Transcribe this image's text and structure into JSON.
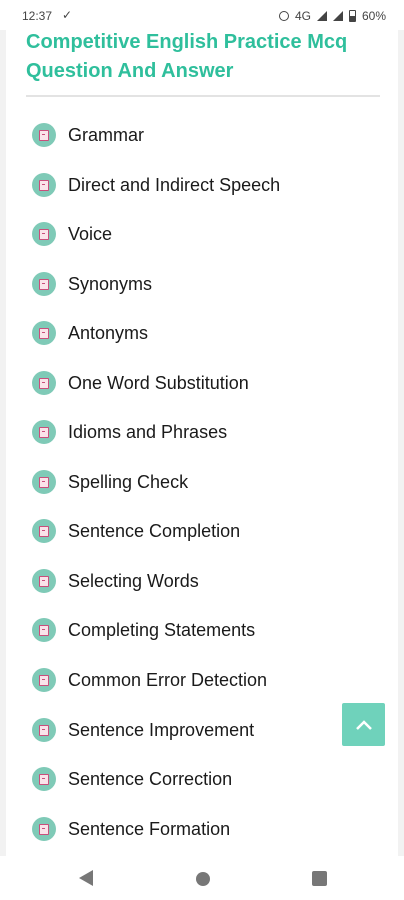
{
  "status_bar": {
    "time": "12:37",
    "check_icon": "check-icon",
    "network": "4G",
    "battery": "60%"
  },
  "page": {
    "title": "Competitive English Practice Mcq Question And Answer",
    "accent_color": "#2fbf9c"
  },
  "topics": [
    {
      "label": "Grammar",
      "icon": "book-icon"
    },
    {
      "label": "Direct and Indirect Speech",
      "icon": "book-icon"
    },
    {
      "label": "Voice",
      "icon": "book-icon"
    },
    {
      "label": "Synonyms",
      "icon": "book-icon"
    },
    {
      "label": "Antonyms",
      "icon": "book-icon"
    },
    {
      "label": "One Word Substitution",
      "icon": "book-icon"
    },
    {
      "label": "Idioms and Phrases",
      "icon": "book-icon"
    },
    {
      "label": "Spelling Check",
      "icon": "book-icon"
    },
    {
      "label": "Sentence Completion",
      "icon": "book-icon"
    },
    {
      "label": "Selecting Words",
      "icon": "book-icon"
    },
    {
      "label": "Completing Statements",
      "icon": "book-icon"
    },
    {
      "label": "Common Error Detection",
      "icon": "book-icon"
    },
    {
      "label": "Sentence Improvement",
      "icon": "book-icon"
    },
    {
      "label": "Sentence Correction",
      "icon": "book-icon"
    },
    {
      "label": "Sentence Formation",
      "icon": "book-icon"
    }
  ],
  "scroll_top": {
    "icon": "chevron-up-icon",
    "color": "#6fd2bb"
  },
  "nav_bar": {
    "back": "back-icon",
    "home": "home-icon",
    "recent": "recent-apps-icon"
  }
}
